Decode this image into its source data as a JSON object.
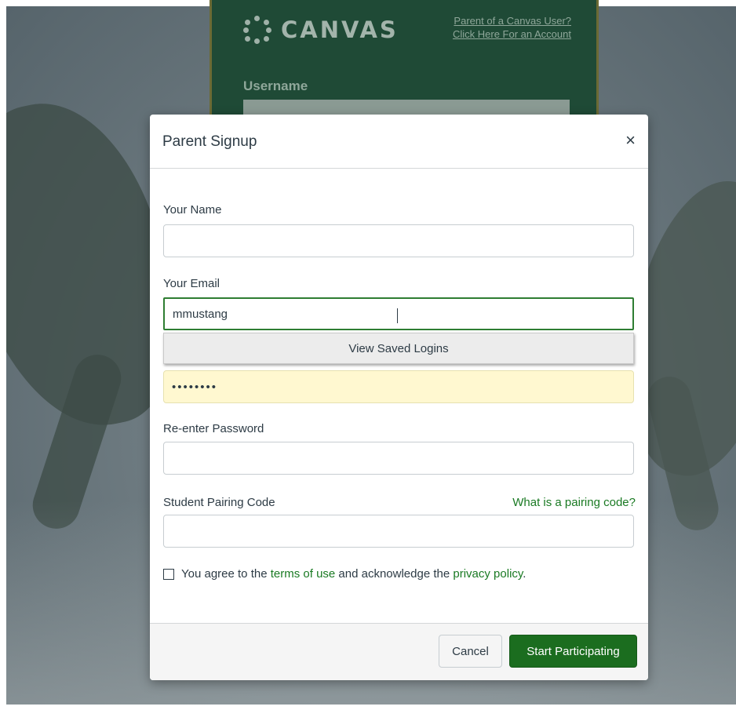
{
  "background": {
    "brand": {
      "logo_icon": "canvas-dots-icon",
      "logo_text": "CANVAS"
    },
    "parent_link": {
      "line1": "Parent of a Canvas User?",
      "line2": "Click Here For an Account"
    },
    "username_label": "Username"
  },
  "modal": {
    "title": "Parent Signup",
    "close_icon": "close-icon",
    "close_glyph": "×",
    "fields": {
      "name": {
        "label": "Your Name",
        "value": ""
      },
      "email": {
        "label": "Your Email",
        "value": "mmustang"
      },
      "password": {
        "value": "••••••••"
      },
      "reenter_password": {
        "label": "Re-enter Password",
        "value": ""
      },
      "pairing_code": {
        "label": "Student Pairing Code",
        "help_link": "What is a pairing code?",
        "value": ""
      }
    },
    "autocomplete": {
      "label": "View Saved Logins"
    },
    "agreement": {
      "prefix": "You agree to the",
      "terms_link": "terms of use",
      "middle": "and acknowledge the",
      "privacy_link": "privacy policy",
      "suffix": ".",
      "checked": false
    },
    "buttons": {
      "cancel": "Cancel",
      "submit": "Start Participating"
    }
  },
  "colors": {
    "accent": "#1b6d1f",
    "link": "#1a7a23",
    "card_background": "#1f4a36",
    "autofill": "#fff8d0"
  }
}
